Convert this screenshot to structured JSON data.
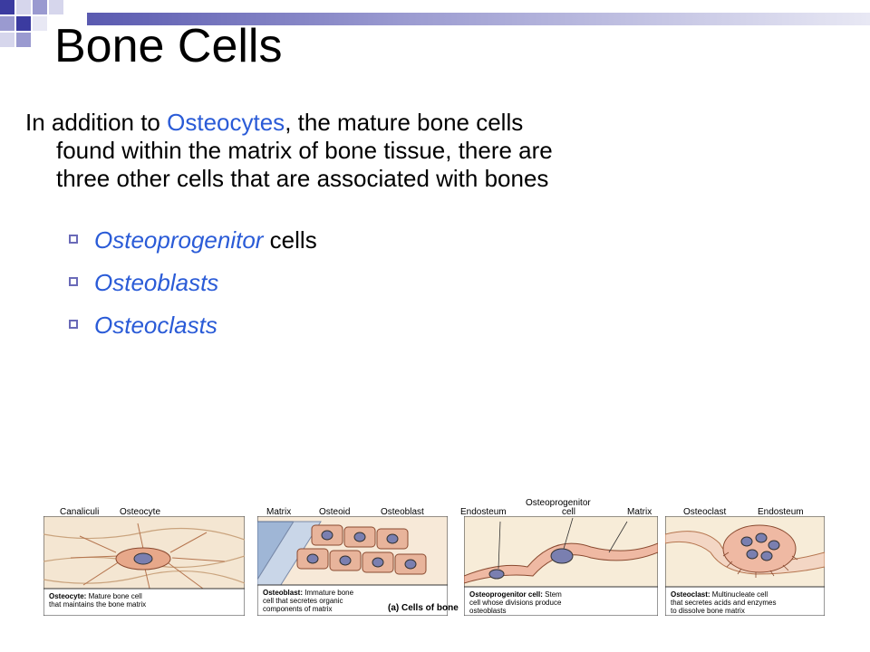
{
  "slide": {
    "title": "Bone Cells",
    "intro_part1": "In addition to ",
    "intro_highlight": "Osteocytes",
    "intro_part2": ", the mature bone cells",
    "intro_line2": "found within the matrix of bone tissue, there are",
    "intro_line3": "three other cells that are associated with bones",
    "bullets": [
      {
        "highlight": "Osteoprogenitor",
        "rest": " cells"
      },
      {
        "highlight": "Osteoblasts",
        "rest": ""
      },
      {
        "highlight": "Osteoclasts",
        "rest": ""
      }
    ]
  },
  "figure": {
    "caption": "(a) Cells of bone",
    "panel1": {
      "labels": [
        "Canaliculi",
        "Osteocyte"
      ],
      "caption_bold": "Osteocyte:",
      "caption_line1": " Mature bone cell",
      "caption_line2": "that maintains the bone matrix"
    },
    "panel2": {
      "labels": [
        "Matrix",
        "Osteoid",
        "Osteoblast"
      ],
      "caption_bold": "Osteoblast:",
      "caption_line1": " Immature bone",
      "caption_line2": "cell that secretes organic",
      "caption_line3": "components of matrix"
    },
    "panel3": {
      "labels": [
        "Endosteum",
        "Osteoprogenitor",
        "cell",
        "Matrix"
      ],
      "caption_bold": "Osteoprogenitor cell:",
      "caption_line1": " Stem",
      "caption_line2": "cell whose divisions produce",
      "caption_line3": "osteoblasts"
    },
    "panel4": {
      "labels": [
        "Osteoclast",
        "Endosteum"
      ],
      "caption_bold": "Osteoclast:",
      "caption_line1": " Multinucleate cell",
      "caption_line2": "that secretes acids and enzymes",
      "caption_line3": "to dissolve bone matrix"
    }
  },
  "colors": {
    "accent": "#2a5bd7",
    "decor": "#3b3ba0",
    "tissue": "#f2c9b8",
    "matrix": "#f5e9c8"
  }
}
